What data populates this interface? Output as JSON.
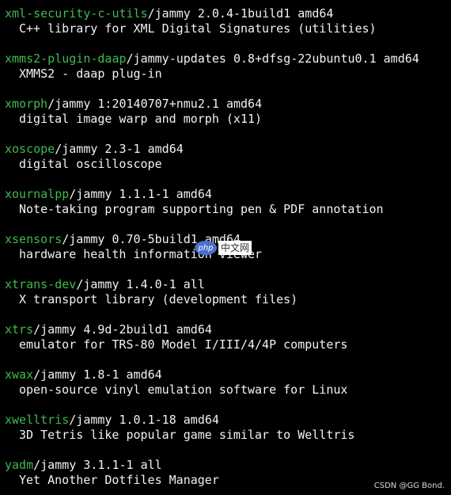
{
  "entries": [
    {
      "name": "xml-security-c-utils",
      "info": "/jammy 2.0.4-1build1 amd64",
      "description": "C++ library for XML Digital Signatures (utilities)"
    },
    {
      "name": "xmms2-plugin-daap",
      "info": "/jammy-updates 0.8+dfsg-22ubuntu0.1 amd64",
      "description": "XMMS2 - daap plug-in"
    },
    {
      "name": "xmorph",
      "info": "/jammy 1:20140707+nmu2.1 amd64",
      "description": "digital image warp and morph (x11)"
    },
    {
      "name": "xoscope",
      "info": "/jammy 2.3-1 amd64",
      "description": "digital oscilloscope"
    },
    {
      "name": "xournalpp",
      "info": "/jammy 1.1.1-1 amd64",
      "description": "Note-taking program supporting pen & PDF annotation"
    },
    {
      "name": "xsensors",
      "info": "/jammy 0.70-5build1 amd64",
      "description": "hardware health information viewer"
    },
    {
      "name": "xtrans-dev",
      "info": "/jammy 1.4.0-1 all",
      "description": "X transport library (development files)"
    },
    {
      "name": "xtrs",
      "info": "/jammy 4.9d-2build1 amd64",
      "description": "emulator for TRS-80 Model I/III/4/4P computers"
    },
    {
      "name": "xwax",
      "info": "/jammy 1.8-1 amd64",
      "description": "open-source vinyl emulation software for Linux"
    },
    {
      "name": "xwelltris",
      "info": "/jammy 1.0.1-18 amd64",
      "description": "3D Tetris like popular game similar to Welltris"
    },
    {
      "name": "yadm",
      "info": "/jammy 3.1.1-1 all",
      "description": "Yet Another Dotfiles Manager"
    }
  ],
  "watermark": {
    "logo": "php",
    "text": "中文网"
  },
  "credit": "CSDN @GG Bond.",
  "colors": {
    "background": "#000000",
    "package_name": "#3fb950",
    "text": "#f2f2f2"
  }
}
